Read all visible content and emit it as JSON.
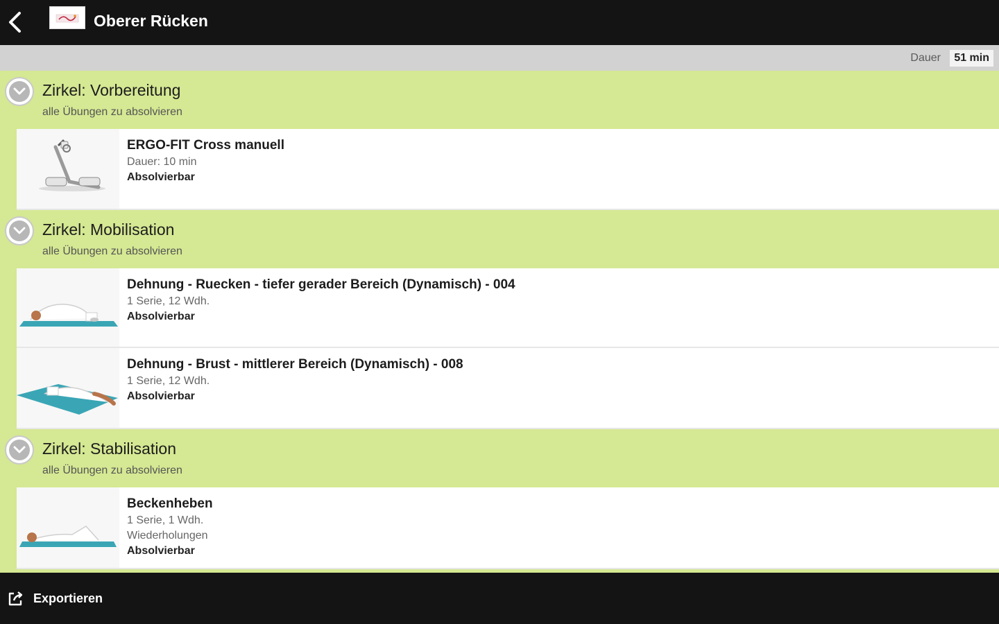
{
  "header": {
    "title": "Oberer Rücken",
    "back_icon": "chevron-left-icon",
    "logo_icon": "app-logo"
  },
  "duration": {
    "label": "Dauer",
    "value": "51 min"
  },
  "circles": [
    {
      "title": "Zirkel: Vorbereitung",
      "subtitle": "alle Übungen zu absolvieren",
      "exercises": [
        {
          "name": "ERGO-FIT Cross manuell",
          "lines": [
            "Dauer: 10 min"
          ],
          "status": "Absolvierbar",
          "image": "cross-trainer-machine"
        }
      ]
    },
    {
      "title": "Zirkel: Mobilisation",
      "subtitle": "alle Übungen zu absolvieren",
      "exercises": [
        {
          "name": "Dehnung - Ruecken - tiefer gerader Bereich (Dynamisch) - 004",
          "lines": [
            "1 Serie, 12 Wdh."
          ],
          "status": "Absolvierbar",
          "image": "stretch-child-pose"
        },
        {
          "name": "Dehnung - Brust - mittlerer Bereich (Dynamisch) - 008",
          "lines": [
            "1 Serie, 12 Wdh."
          ],
          "status": "Absolvierbar",
          "image": "stretch-lying-twist"
        }
      ]
    },
    {
      "title": "Zirkel: Stabilisation",
      "subtitle": "alle Übungen zu absolvieren",
      "exercises": [
        {
          "name": "Beckenheben",
          "lines": [
            "1 Serie, 1 Wdh.",
            "Wiederholungen"
          ],
          "status": "Absolvierbar",
          "image": "pelvic-lift"
        }
      ]
    }
  ],
  "footer": {
    "export_label": "Exportieren",
    "export_icon": "share-export-icon"
  },
  "colors": {
    "bar": "#141414",
    "circle_bg": "#d5e893",
    "duration_bar": "#d2d2d2",
    "mat": "#3aa6b5"
  }
}
